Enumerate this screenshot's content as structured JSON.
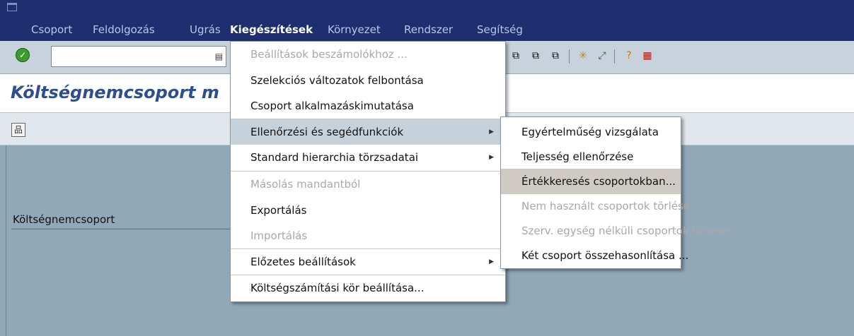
{
  "menubar": {
    "items": [
      "Csoport",
      "Feldolgozás",
      "Ugrás",
      "Kiegészítések",
      "Környezet",
      "Rendszer",
      "Segítség"
    ]
  },
  "toolbar": {
    "command_value": "",
    "icons": [
      "ok-check-icon",
      "command-history-icon",
      "new-session-icon",
      "shortcut-icon",
      "layout-menu-icon",
      "help-icon",
      "customize-icon"
    ]
  },
  "app": {
    "title": "Költségnemcsoport m",
    "field_label": "Költségnemcsoport"
  },
  "menu_main": {
    "items": [
      {
        "label": "Beállítások beszámolókhoz ...",
        "state": "disabled"
      },
      {
        "label": "Szelekciós változatok felbontása",
        "state": "normal"
      },
      {
        "label": "Csoport alkalmazáskimutatása",
        "state": "normal"
      },
      {
        "label": "Ellenőrzési és segédfunkciók",
        "state": "highlighted",
        "submenu": true
      },
      {
        "label": "Standard hierarchia törzsadatai",
        "state": "normal",
        "submenu": true
      },
      {
        "label": "Másolás mandantból",
        "state": "disabled"
      },
      {
        "label": "Exportálás",
        "state": "normal"
      },
      {
        "label": "Importálás",
        "state": "disabled"
      },
      {
        "label": "Előzetes beállítások",
        "state": "normal",
        "submenu": true
      },
      {
        "label": "Költségszámítási kör beállítása...",
        "state": "normal"
      }
    ]
  },
  "menu_sub": {
    "items": [
      {
        "label": "Egyértelműség vizsgálata",
        "state": "normal"
      },
      {
        "label": "Teljesség ellenőrzése",
        "state": "normal"
      },
      {
        "label": "Értékkeresés csoportokban...",
        "state": "selected"
      },
      {
        "label": "Nem használt csoportok törlése",
        "state": "disabled"
      },
      {
        "label": "Szerv. egység nélküli csoportok törlése",
        "state": "disabled"
      },
      {
        "label": "Két csoport összehasonlítása ...",
        "state": "normal"
      }
    ]
  },
  "colors": {
    "menubar_bg": "#1e2e6e",
    "title_text": "#2e4e8c",
    "workspace_bg": "#91a8b9",
    "highlight_bg": "#c5d2dc",
    "selected_bg": "#cfcbc4"
  }
}
